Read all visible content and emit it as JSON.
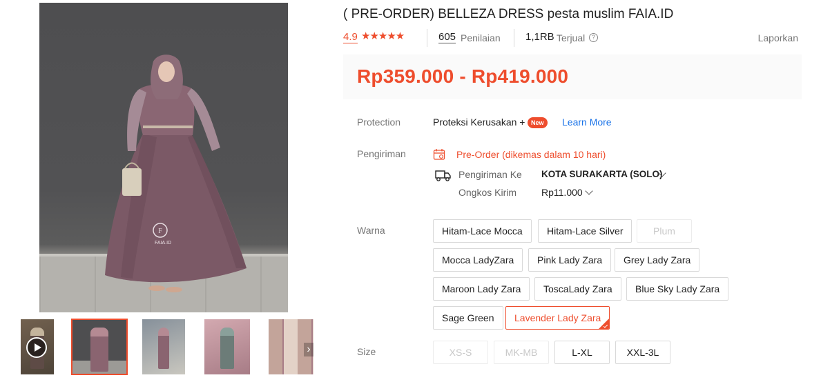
{
  "product": {
    "title": "( PRE-ORDER) BELLEZA DRESS pesta muslim FAIA.ID",
    "rating": "4.9",
    "stars_icon": "star-icon",
    "review_count": "605",
    "review_label": "Penilaian",
    "sold_count": "1,1RB",
    "sold_label": "Terjual",
    "report_label": "Laporkan",
    "price_range": "Rp359.000 - Rp419.000",
    "main_image_watermark": "FAIA.ID"
  },
  "protection": {
    "label": "Protection",
    "name": "Proteksi Kerusakan +",
    "badge": "New",
    "learn_more": "Learn More"
  },
  "shipping": {
    "label": "Pengiriman",
    "preorder": "Pre-Order (dikemas dalam 10 hari)",
    "to_label": "Pengiriman Ke",
    "to_value": "KOTA SURAKARTA (SOLO)",
    "cost_label": "Ongkos Kirim",
    "cost_value": "Rp11.000"
  },
  "variants": {
    "color_label": "Warna",
    "colors": [
      {
        "label": "Hitam-Lace Mocca",
        "state": "normal"
      },
      {
        "label": "Hitam-Lace Silver",
        "state": "normal"
      },
      {
        "label": "Plum",
        "state": "disabled"
      },
      {
        "label": "Mocca LadyZara",
        "state": "normal"
      },
      {
        "label": "Pink Lady Zara",
        "state": "normal"
      },
      {
        "label": "Grey Lady Zara",
        "state": "normal"
      },
      {
        "label": "Maroon Lady Zara",
        "state": "normal"
      },
      {
        "label": "ToscaLady Zara",
        "state": "normal"
      },
      {
        "label": "Blue Sky Lady Zara",
        "state": "normal"
      },
      {
        "label": "Sage Green",
        "state": "normal"
      },
      {
        "label": "Lavender Lady Zara",
        "state": "selected"
      }
    ],
    "size_label": "Size",
    "sizes": [
      {
        "label": "XS-S",
        "state": "disabled"
      },
      {
        "label": "MK-MB",
        "state": "disabled"
      },
      {
        "label": "L-XL",
        "state": "normal"
      },
      {
        "label": "XXL-3L",
        "state": "normal"
      }
    ]
  },
  "colors": {
    "accent": "#ee4d2d",
    "link": "#1a73e8",
    "dress": "#7d5a66"
  }
}
